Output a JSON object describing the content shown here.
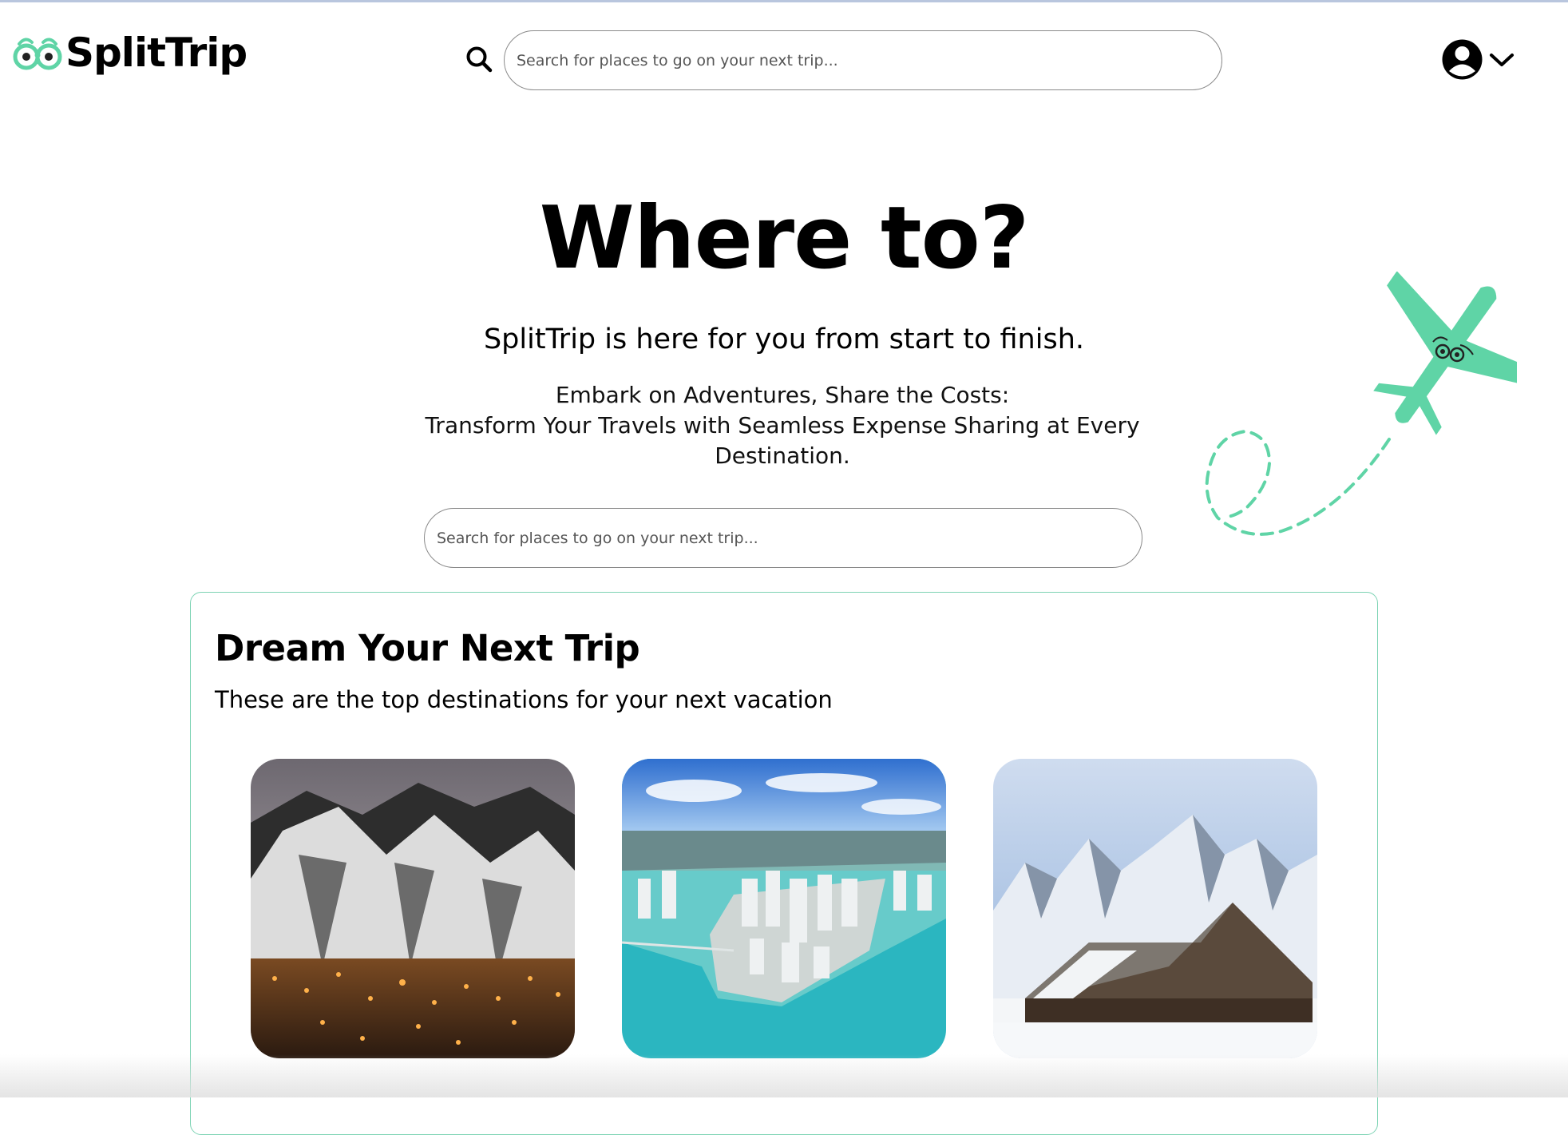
{
  "brand": {
    "name": "SplitTrip",
    "logo_icon": "binoculars-eyes-logo",
    "accent_color": "#5fd4a6"
  },
  "header": {
    "search_icon": "search-icon",
    "search_placeholder": "Search for places to go on your next trip...",
    "account_icon": "user-avatar-icon",
    "dropdown_icon": "chevron-down-icon"
  },
  "hero": {
    "title": "Where to?",
    "subtitle": "SplitTrip is here for you from start to finish.",
    "line1": "Embark on Adventures, Share the Costs:",
    "line2": "Transform Your Travels with Seamless Expense Sharing at Every Destination.",
    "search_placeholder": "Search for places to go on your next trip...",
    "decoration": "airplane-with-dashed-trail"
  },
  "destinations_section": {
    "title": "Dream Your Next Trip",
    "subtitle": "These are the top destinations for your next vacation",
    "cards": [
      {
        "image": "snowy-ski-mountain-town-at-dusk"
      },
      {
        "image": "aerial-city-island-turquoise-water"
      },
      {
        "image": "snowy-mountains-wooden-barn"
      }
    ]
  }
}
